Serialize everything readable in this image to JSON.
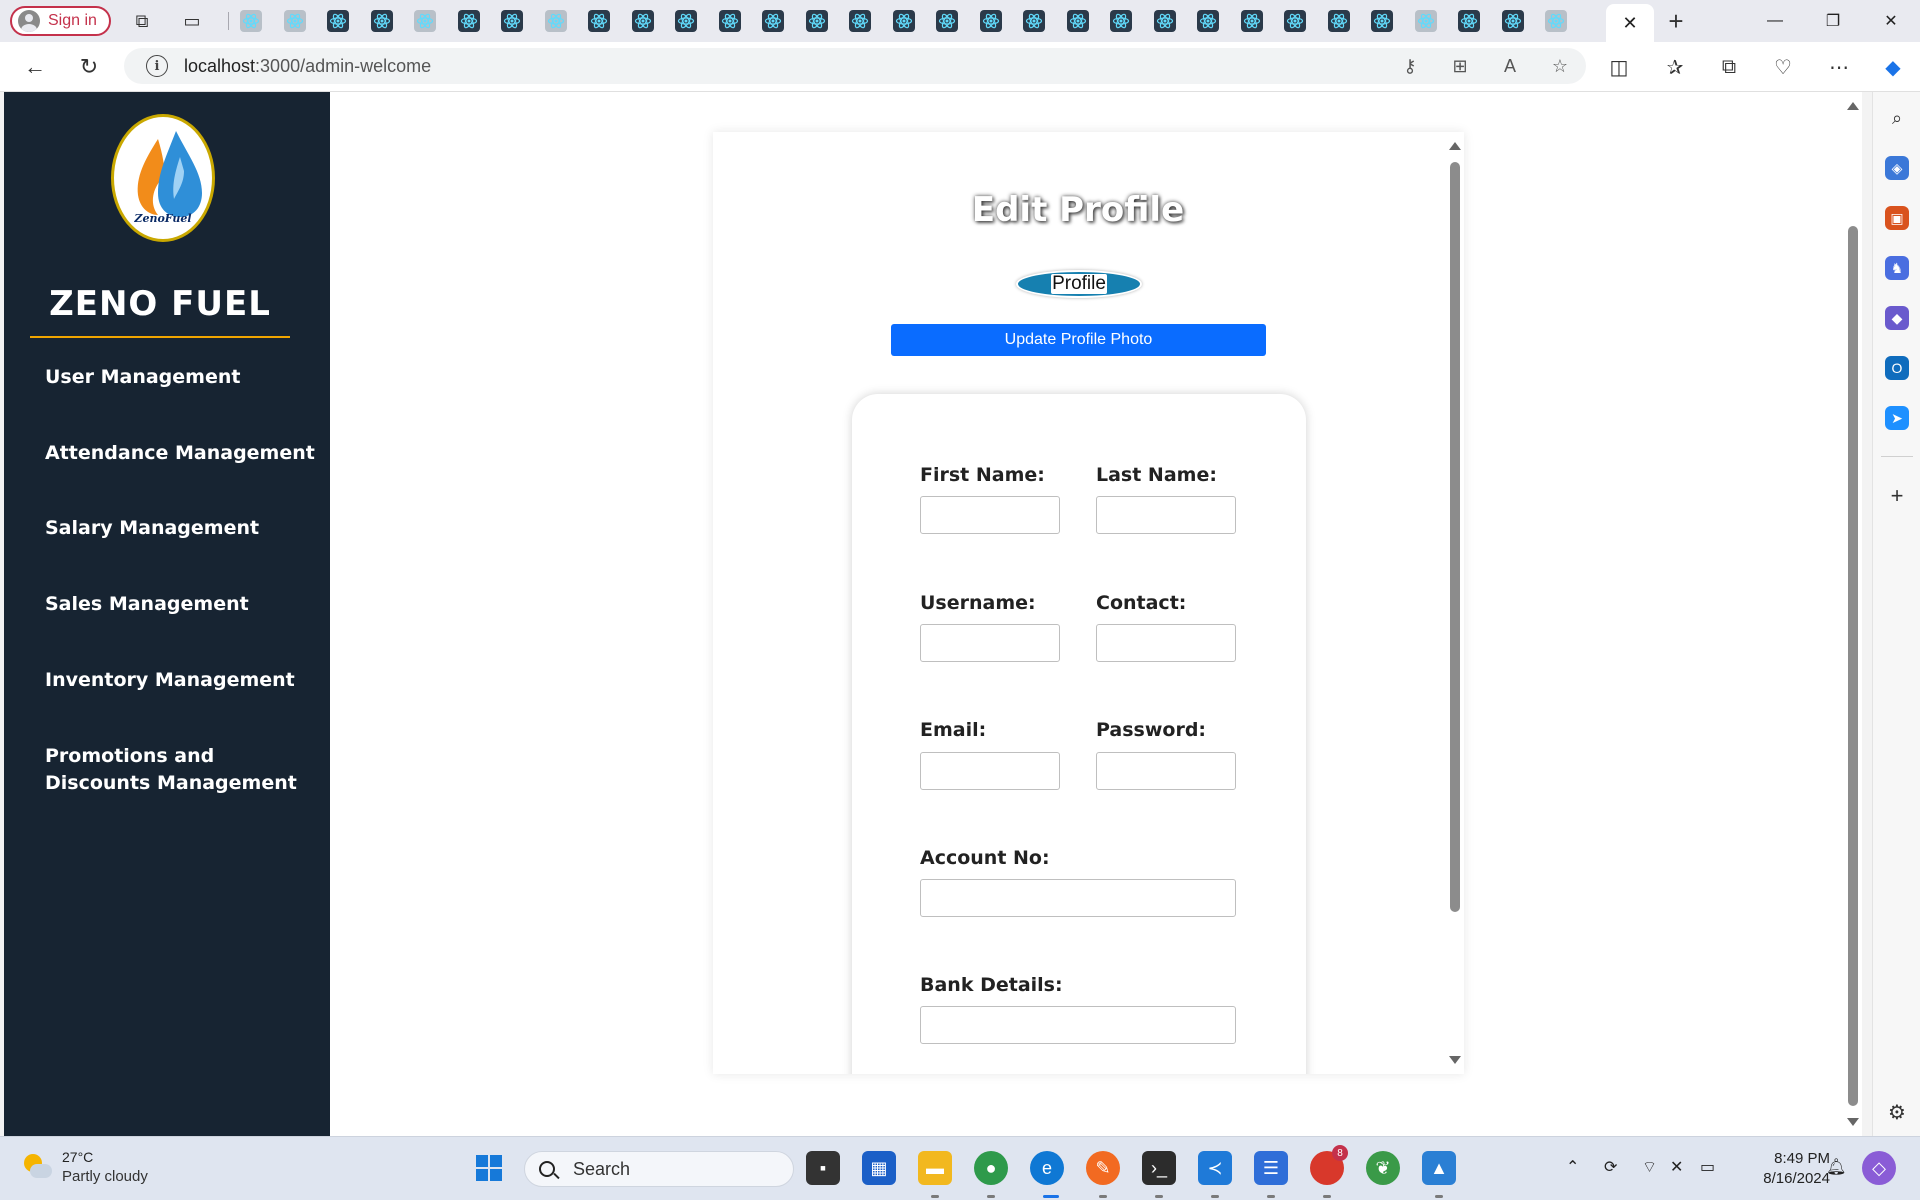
{
  "browser": {
    "signin_label": "Sign in",
    "url_host": "localhost",
    "url_path": ":3000/admin-welcome",
    "tab_close": "✕",
    "new_tab": "+",
    "window": {
      "minimize": "—",
      "restore": "❐",
      "close": "✕"
    }
  },
  "sidebar": {
    "logo_caption": "ZenoFuel",
    "brand": "ZENO FUEL",
    "items": [
      {
        "label": "User Management"
      },
      {
        "label": "Attendance Management"
      },
      {
        "label": "Salary Management"
      },
      {
        "label": "Sales Management"
      },
      {
        "label": "Inventory Management"
      },
      {
        "label": "Promotions and Discounts Management"
      }
    ]
  },
  "profile": {
    "title": "Edit Profile",
    "photo_alt": "Profile",
    "update_photo_label": "Update Profile Photo",
    "fields": {
      "first_name": {
        "label": "First Name:",
        "value": ""
      },
      "last_name": {
        "label": "Last Name:",
        "value": ""
      },
      "username": {
        "label": "Username:",
        "value": ""
      },
      "contact": {
        "label": "Contact:",
        "value": ""
      },
      "email": {
        "label": "Email:",
        "value": ""
      },
      "password": {
        "label": "Password:",
        "value": ""
      },
      "account_no": {
        "label": "Account No:",
        "value": ""
      },
      "bank_details": {
        "label": "Bank Details:",
        "value": ""
      }
    }
  },
  "taskbar": {
    "weather_temp": "27°C",
    "weather_condition": "Partly cloudy",
    "search_label": "Search",
    "time": "8:49 PM",
    "date": "8/16/2024",
    "chrome_badge": "8"
  },
  "colors": {
    "sidebar_bg": "#172432",
    "brand_underline": "#f0a500",
    "update_button": "#0a6cff",
    "signin_accent": "#c4314b"
  }
}
